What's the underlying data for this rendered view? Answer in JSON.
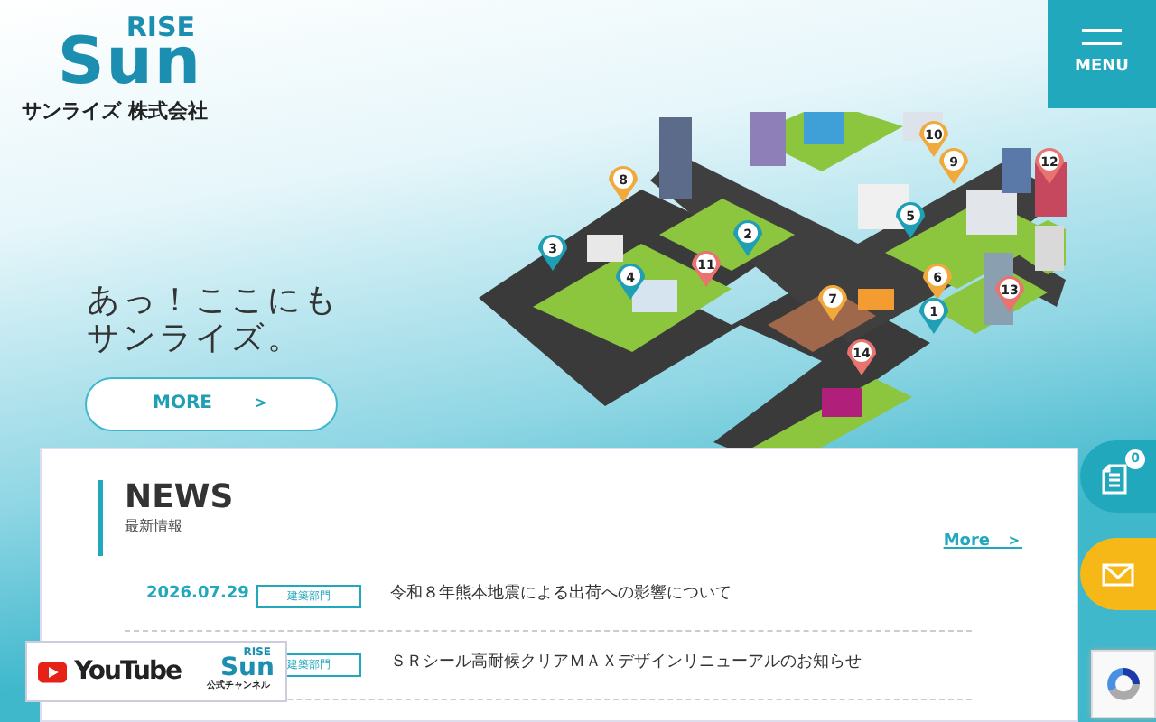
{
  "logo": {
    "mark_word": "Sun",
    "mark_text": "RISE",
    "company": "サンライズ 株式会社"
  },
  "menu_button": {
    "label": "MENU"
  },
  "hero": {
    "headline_lines": [
      "あっ！ここにも",
      "サンライズ。"
    ],
    "more_button": {
      "label": "MORE",
      "arrow": "＞"
    }
  },
  "map_pins": [
    {
      "number": "8",
      "color": "#f2a93b"
    },
    {
      "number": "10",
      "color": "#f2a93b"
    },
    {
      "number": "9",
      "color": "#f2a93b"
    },
    {
      "number": "12",
      "color": "#e8736f"
    },
    {
      "number": "3",
      "color": "#1e9fb4"
    },
    {
      "number": "2",
      "color": "#1e9fb4"
    },
    {
      "number": "5",
      "color": "#1e9fb4"
    },
    {
      "number": "11",
      "color": "#e8736f"
    },
    {
      "number": "4",
      "color": "#1e9fb4"
    },
    {
      "number": "6",
      "color": "#f2a93b"
    },
    {
      "number": "7",
      "color": "#f2a93b"
    },
    {
      "number": "13",
      "color": "#e8736f"
    },
    {
      "number": "1",
      "color": "#1e9fb4"
    },
    {
      "number": "14",
      "color": "#e8736f"
    }
  ],
  "news": {
    "title": "NEWS",
    "subtitle": "最新情報",
    "more_link": "More　＞",
    "items": [
      {
        "date": "2026.07.29",
        "category": "建築部門",
        "title": "令和８年熊本地震による出荷への影響について"
      },
      {
        "category": "建築部門",
        "title": "ＳＲシール高耐候クリアＭＡＸデザインリニューアルのお知らせ"
      }
    ]
  },
  "side_buttons": [
    {
      "kind": "document",
      "badge": "0"
    },
    {
      "kind": "mail"
    }
  ],
  "youtube_badge": {
    "label": "YouTube",
    "channel_word": "Sun",
    "channel_mark": "RISE",
    "caption": "公式チャンネル"
  }
}
